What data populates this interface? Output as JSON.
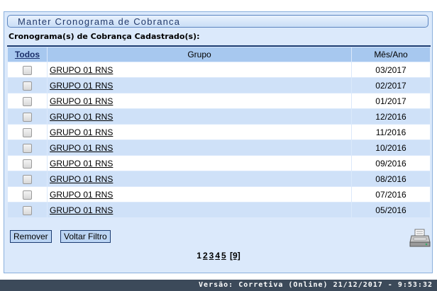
{
  "header": {
    "title": "Manter Cronograma de Cobranca"
  },
  "subtitle": "Cronograma(s) de Cobrança Cadastrado(s):",
  "table": {
    "columns": {
      "select_all": "Todos",
      "group": "Grupo",
      "month_year": "Mês/Ano"
    },
    "rows": [
      {
        "group": "GRUPO 01 RNS",
        "month_year": "03/2017"
      },
      {
        "group": "GRUPO 01 RNS",
        "month_year": "02/2017"
      },
      {
        "group": "GRUPO 01 RNS",
        "month_year": "01/2017"
      },
      {
        "group": "GRUPO 01 RNS",
        "month_year": "12/2016"
      },
      {
        "group": "GRUPO 01 RNS",
        "month_year": "11/2016"
      },
      {
        "group": "GRUPO 01 RNS",
        "month_year": "10/2016"
      },
      {
        "group": "GRUPO 01 RNS",
        "month_year": "09/2016"
      },
      {
        "group": "GRUPO 01 RNS",
        "month_year": "08/2016"
      },
      {
        "group": "GRUPO 01 RNS",
        "month_year": "07/2016"
      },
      {
        "group": "GRUPO 01 RNS",
        "month_year": "05/2016"
      }
    ]
  },
  "buttons": {
    "remove": "Remover",
    "back": "Voltar Filtro"
  },
  "icons": {
    "print": "printer-icon"
  },
  "pagination": {
    "current": "1",
    "pages": [
      "2",
      "3",
      "4",
      "5"
    ],
    "last": "[9]"
  },
  "footer": {
    "version": "Versão: Corretiva (Online) 21/12/2017 - 9:53:32"
  }
}
